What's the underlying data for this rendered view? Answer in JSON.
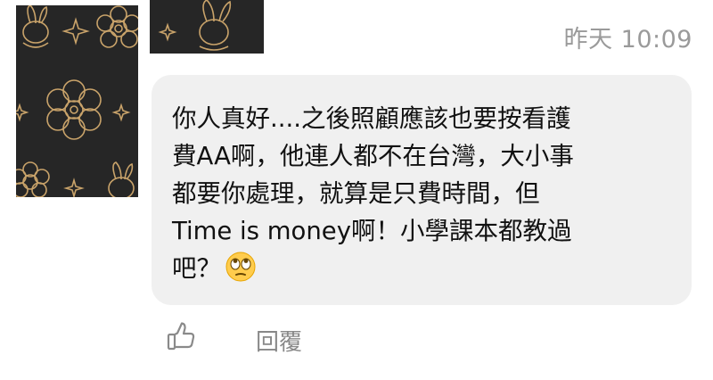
{
  "comment": {
    "timestamp": "昨天 10:09",
    "lines": [
      "你人真好....之後照顧應該也要按看護",
      "費AA啊，他連人都不在台灣，大小事",
      "都要你處理，就算是只費時間，但",
      "Time is money啊！小學課本都教過",
      "吧？"
    ],
    "emoji": "face-with-rolling-eyes"
  },
  "actions": {
    "like_icon": "thumbs-up-icon",
    "reply_label": "回覆"
  },
  "colors": {
    "avatar_bg": "#262626",
    "avatar_line": "#c9a36a",
    "bubble_bg": "#f0f0f0",
    "text": "#111111",
    "muted": "#9a9a9a"
  }
}
